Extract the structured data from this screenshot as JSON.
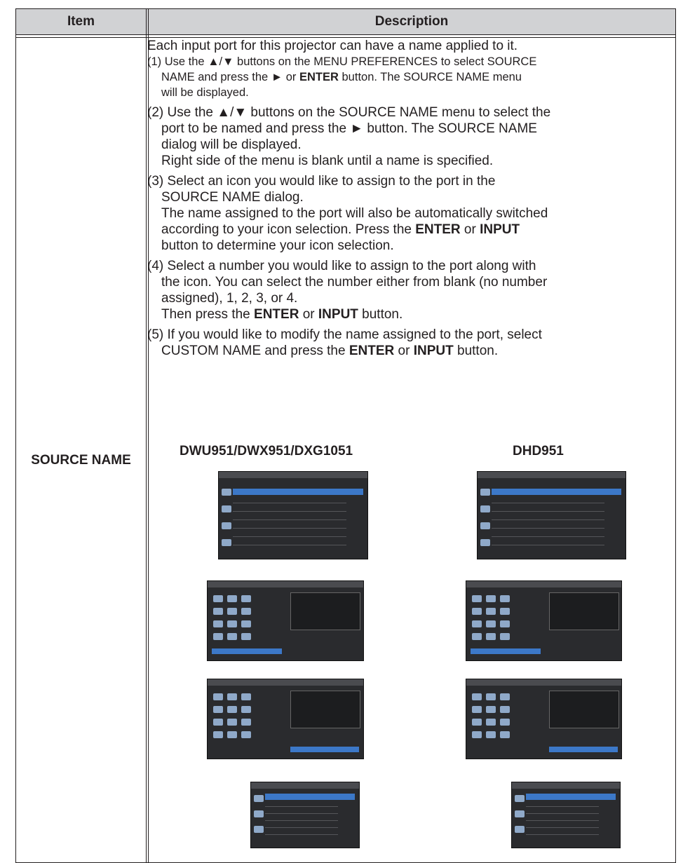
{
  "table": {
    "header_item": "Item",
    "header_description": "Description",
    "item_name": "SOURCE NAME"
  },
  "description": {
    "intro": "Each input port for this projector can have a name applied to it.",
    "step1": {
      "a": "(1) Use the ▲/▼ buttons on the MENU PREFERENCES to select SOURCE",
      "b_pre": "NAME and press the ► or ",
      "b_bold": "ENTER",
      "b_post": " button. The SOURCE NAME menu",
      "c": "will be displayed."
    },
    "step2": {
      "a": "(2) Use the ▲/▼ buttons on the SOURCE NAME menu to select the",
      "b": "port to be named and press the ► button. The SOURCE NAME",
      "c": "dialog will be displayed.",
      "d": "Right side of the menu is blank until a name is specified."
    },
    "step3": {
      "a": "(3) Select an icon you would like to assign to the port in the",
      "b": "SOURCE NAME dialog.",
      "c": "The name assigned to the port will also be automatically switched",
      "d_pre": "according to your icon selection. Press the ",
      "d_bold1": "ENTER",
      "d_mid": " or ",
      "d_bold2": "INPUT",
      "e": "button to determine your icon selection."
    },
    "step4": {
      "a": "(4) Select a number you would like to assign to the port along with",
      "b": "the icon. You can select the number either from blank (no number",
      "c": "assigned), 1, 2, 3, or 4.",
      "d_pre": "Then press the ",
      "d_bold1": "ENTER",
      "d_mid": " or ",
      "d_bold2": "INPUT",
      "d_post": " button."
    },
    "step5": {
      "a": "(5) If you would like to modify the name assigned to the port, select",
      "b_pre": "CUSTOM NAME and press the ",
      "b_bold1": "ENTER",
      "b_mid": " or ",
      "b_bold2": "INPUT",
      "b_post": " button."
    }
  },
  "models": {
    "left": "DWU951/DWX951/DXG1051",
    "right": "DHD951"
  }
}
